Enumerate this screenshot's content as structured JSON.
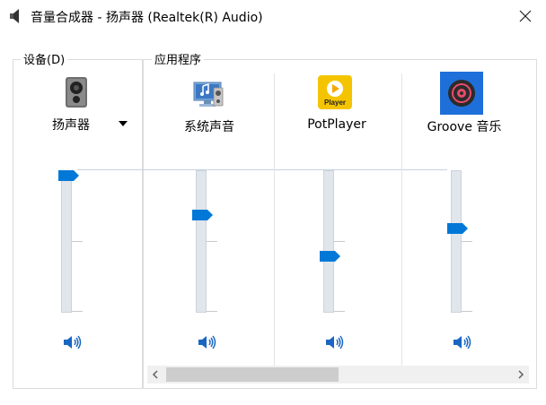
{
  "window": {
    "title": "音量合成器 - 扬声器 (Realtek(R) Audio)",
    "close_icon": "close-icon"
  },
  "colors": {
    "accent": "#0078d7",
    "speaker_icon": "#1a66c2",
    "track": "#e1e6ec",
    "border": "#dcdcdc"
  },
  "device": {
    "group_label": "设备(D)",
    "name": "扬声器",
    "icon": "speaker-device-icon",
    "volume_percent": 100,
    "muted": false
  },
  "applications": {
    "group_label": "应用程序",
    "items": [
      {
        "name": "系统声音",
        "icon": "system-sounds-icon",
        "volume_percent": 70,
        "muted": false
      },
      {
        "name": "PotPlayer",
        "icon": "potplayer-icon",
        "volume_percent": 38,
        "muted": false
      },
      {
        "name": "Groove 音乐",
        "icon": "groove-music-icon",
        "volume_percent": 59,
        "muted": false
      }
    ]
  },
  "scrollbar": {
    "left_arrow": "‹",
    "right_arrow": "›",
    "position_fraction": 0.0,
    "visible_fraction": 0.5
  }
}
